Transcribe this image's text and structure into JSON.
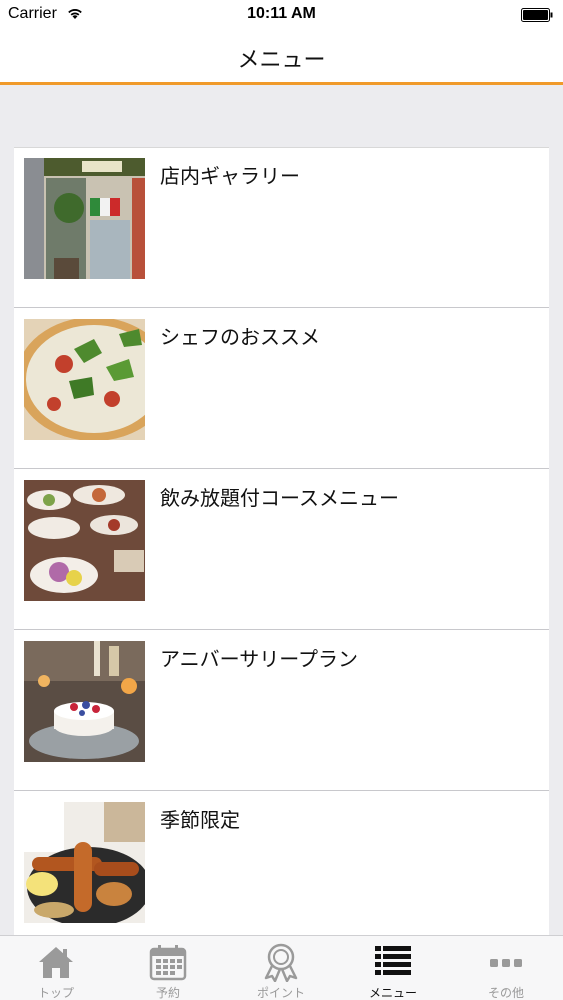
{
  "status_bar": {
    "carrier": "Carrier",
    "time": "10:11 AM"
  },
  "nav": {
    "title": "メニュー"
  },
  "menu_items": [
    {
      "label": "店内ギャラリー",
      "thumb": "storefront-photo"
    },
    {
      "label": "シェフのおススメ",
      "thumb": "pizza-photo"
    },
    {
      "label": "飲み放題付コースメニュー",
      "thumb": "course-dishes-photo"
    },
    {
      "label": "アニバーサリープラン",
      "thumb": "anniversary-cake-photo"
    },
    {
      "label": "季節限定",
      "thumb": "sausage-platter-photo"
    }
  ],
  "tabs": [
    {
      "label": "トップ",
      "icon": "home-icon",
      "active": false
    },
    {
      "label": "予約",
      "icon": "calendar-icon",
      "active": false
    },
    {
      "label": "ポイント",
      "icon": "award-icon",
      "active": false
    },
    {
      "label": "メニュー",
      "icon": "list-icon",
      "active": true
    },
    {
      "label": "その他",
      "icon": "more-icon",
      "active": false
    }
  ],
  "colors": {
    "accent": "#f09a2a",
    "tab_inactive": "#9a9a9a",
    "tab_active": "#111111"
  }
}
